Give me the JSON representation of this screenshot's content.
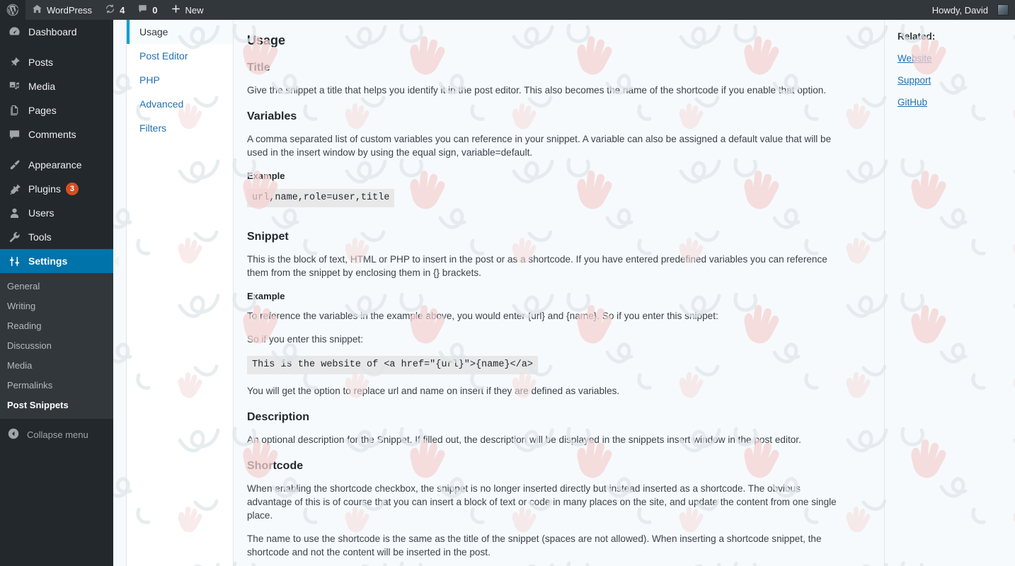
{
  "adminbar": {
    "logo_icon": "wordpress-logo-icon",
    "home_icon": "home-icon",
    "site_name": "WordPress",
    "updates_icon": "updates-icon",
    "updates_count": "4",
    "comments_icon": "comment-bubble-icon",
    "comments_count": "0",
    "new_icon": "plus-icon",
    "new_label": "New",
    "howdy": "Howdy, David",
    "avatar_icon": "avatar"
  },
  "adminmenu": {
    "items": [
      {
        "label": "Dashboard",
        "icon": "dashboard-icon",
        "badge": ""
      },
      {
        "label": "Posts",
        "icon": "pin-icon",
        "badge": ""
      },
      {
        "label": "Media",
        "icon": "media-icon",
        "badge": ""
      },
      {
        "label": "Pages",
        "icon": "pages-icon",
        "badge": ""
      },
      {
        "label": "Comments",
        "icon": "comment-bubble-icon",
        "badge": ""
      },
      {
        "label": "Appearance",
        "icon": "brush-icon",
        "badge": ""
      },
      {
        "label": "Plugins",
        "icon": "plug-icon",
        "badge": "3"
      },
      {
        "label": "Users",
        "icon": "user-icon",
        "badge": ""
      },
      {
        "label": "Tools",
        "icon": "wrench-icon",
        "badge": ""
      },
      {
        "label": "Settings",
        "icon": "settings-sliders-icon",
        "badge": ""
      }
    ],
    "submenu": [
      {
        "label": "General"
      },
      {
        "label": "Writing"
      },
      {
        "label": "Reading"
      },
      {
        "label": "Discussion"
      },
      {
        "label": "Media"
      },
      {
        "label": "Permalinks"
      },
      {
        "label": "Post Snippets"
      }
    ],
    "collapse_label": "Collapse menu",
    "collapse_icon": "chevron-left-circle-icon",
    "active_item": "Settings",
    "active_subitem": "Post Snippets",
    "highlight_color": "#0073aa",
    "badge_color": "#d54e21"
  },
  "tabs": [
    {
      "label": "Usage",
      "active": true
    },
    {
      "label": "Post Editor",
      "active": false
    },
    {
      "label": "PHP",
      "active": false
    },
    {
      "label": "Advanced",
      "active": false
    },
    {
      "label": "Filters",
      "active": false
    }
  ],
  "content": {
    "heading": "Usage",
    "sections": [
      {
        "title": "Title",
        "paragraphs": [
          "Give the snippet a title that helps you identify it in the post editor. This also becomes the name of the shortcode if you enable that option."
        ]
      },
      {
        "title": "Variables",
        "paragraphs": [
          "A comma separated list of custom variables you can reference in your snippet. A variable can also be assigned a default value that will be used in the insert window by using the equal sign, variable=default."
        ],
        "example_label": "Example",
        "code": "url,name,role=user,title"
      },
      {
        "title": "Snippet",
        "paragraphs": [
          "This is the block of text, HTML or PHP to insert in the post or as a shortcode. If you have entered predefined variables you can reference them from the snippet by enclosing them in {} brackets."
        ],
        "example_label": "Example",
        "paragraphs_after_example": [
          "To reference the variables in the example above, you would enter {url} and {name}. So if you enter this snippet:",
          "So if you enter this snippet:"
        ],
        "code": "This is the website of <a href=\"{url}\">{name}</a>",
        "paragraphs_after_code": [
          "You will get the option to replace url and name on insert if they are defined as variables."
        ]
      },
      {
        "title": "Description",
        "paragraphs": [
          "An optional description for the Snippet. If filled out, the description will be displayed in the snippets insert window in the post editor."
        ]
      },
      {
        "title": "Shortcode",
        "paragraphs": [
          "When enabling the shortcode checkbox, the snippet is no longer inserted directly but instead inserted as a shortcode. The obvious advantage of this is of course that you can insert a block of text or code in many places on the site, and update the content from one single place.",
          "The name to use the shortcode is the same as the title of the snippet (spaces are not allowed). When inserting a shortcode snippet, the shortcode and not the content will be inserted in the post."
        ]
      }
    ]
  },
  "related": {
    "title": "Related:",
    "links": [
      {
        "label": "Website"
      },
      {
        "label": "Support"
      },
      {
        "label": "GitHub"
      }
    ]
  },
  "colors": {
    "admin_bar_bg": "#32373c",
    "admin_menu_bg": "#23282d",
    "submenu_bg": "#32373c",
    "accent_blue": "#0073aa",
    "link_blue": "#2271b1",
    "page_bg": "#f6fafc",
    "code_bg": "#e8e8e8",
    "tab_active_border": "#00a0d2"
  }
}
